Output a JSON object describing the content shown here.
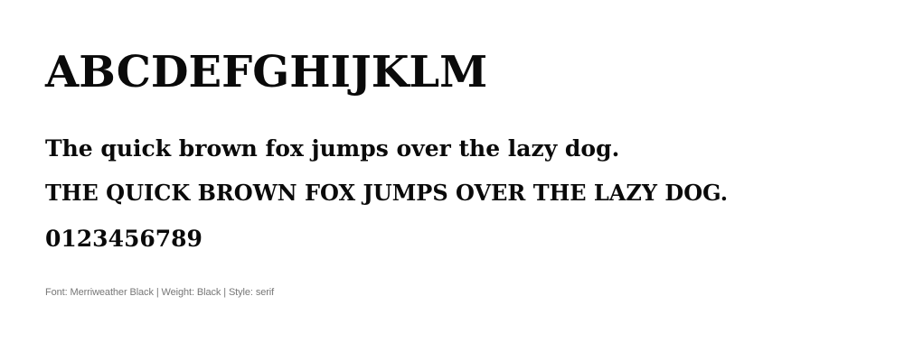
{
  "specimen": {
    "alphabet": "ABCDEFGHIJKLM",
    "pangram": "The quick brown fox jumps over the lazy dog.",
    "pangram_caps": "THE QUICK BROWN FOX JUMPS OVER THE LAZY DOG.",
    "digits": "0123456789",
    "caption": "Font: Merriweather Black | Weight: Black | Style: serif"
  },
  "colors": {
    "text": "#0a0a0a",
    "caption": "#777777",
    "background": "#ffffff"
  }
}
